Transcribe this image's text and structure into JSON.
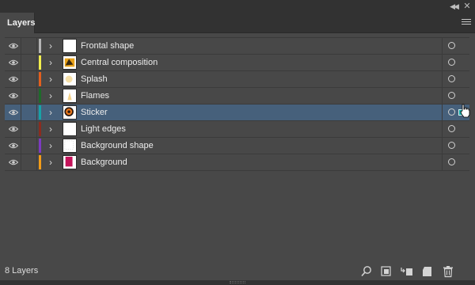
{
  "window": {
    "collapse_icon": "double-chevron-left-icon",
    "close_icon": "close-icon"
  },
  "tab": {
    "label": "Layers"
  },
  "panel_menu_icon": "hamburger-menu-icon",
  "layers": [
    {
      "name": "Frontal shape",
      "color": "#b5b5b5",
      "selected": false
    },
    {
      "name": "Central composition",
      "color": "#f2ee4d",
      "selected": false
    },
    {
      "name": "Splash",
      "color": "#e35f1e",
      "selected": false
    },
    {
      "name": "Flames",
      "color": "#1e6b2a",
      "selected": false
    },
    {
      "name": "Sticker",
      "color": "#17a3a6",
      "selected": true
    },
    {
      "name": "Light edges",
      "color": "#8b2c1f",
      "selected": false
    },
    {
      "name": "Background shape",
      "color": "#7d3ac1",
      "selected": false
    },
    {
      "name": "Background",
      "color": "#f29c18",
      "selected": false
    }
  ],
  "footer": {
    "count": "8 Layers",
    "tools": [
      "search-icon",
      "make-clipping-mask-icon",
      "create-sublayer-icon",
      "create-new-layer-icon",
      "trash-icon"
    ]
  }
}
